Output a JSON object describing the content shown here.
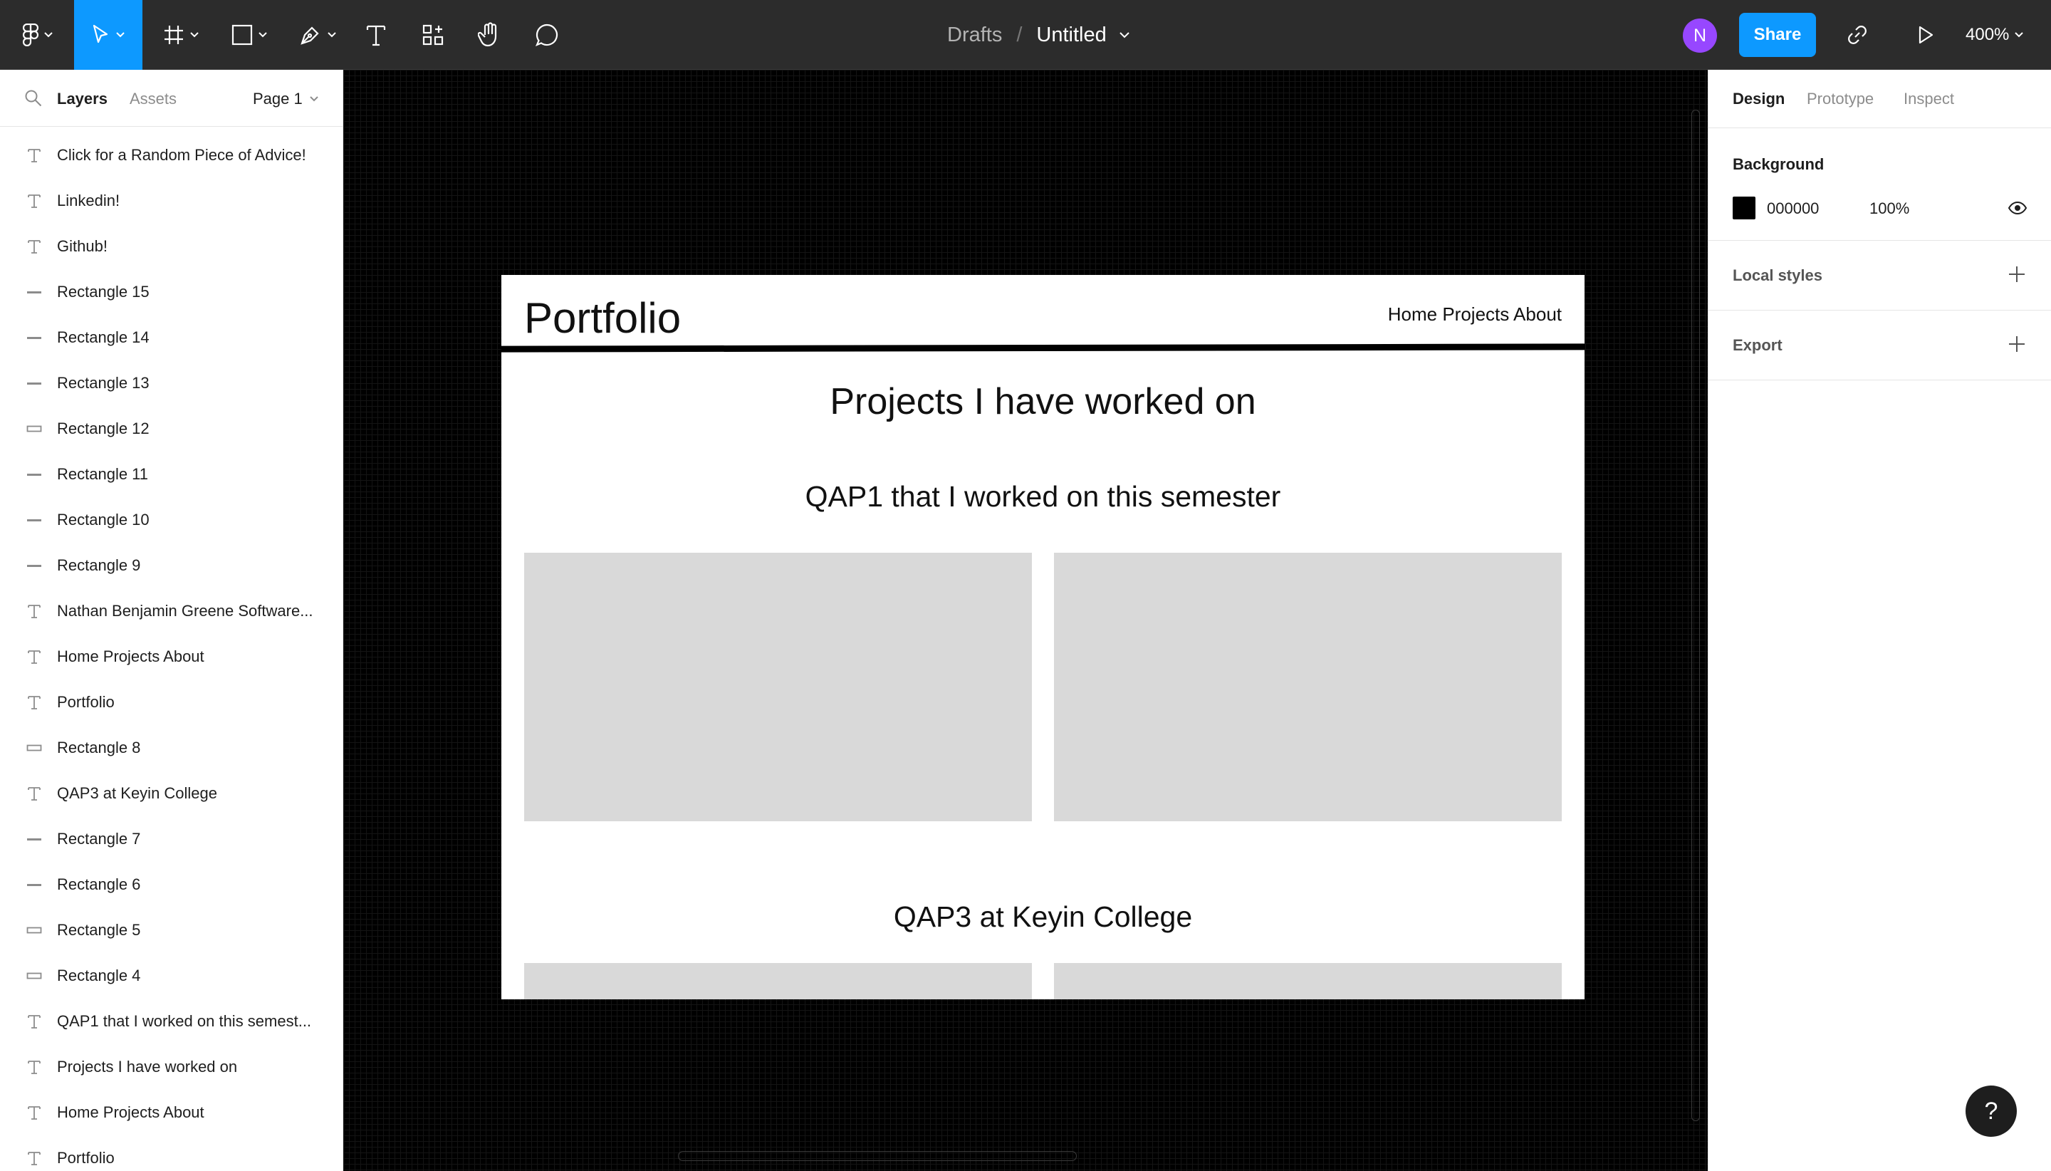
{
  "toolbar": {
    "breadcrumb_parent": "Drafts",
    "breadcrumb_separator": "/",
    "file_name": "Untitled",
    "avatar_initial": "N",
    "share_label": "Share",
    "zoom_level": "400%"
  },
  "left_panel": {
    "tab_layers": "Layers",
    "tab_assets": "Assets",
    "page_selector": "Page 1",
    "layers": [
      {
        "name": "Click for a Random Piece of Advice!",
        "icon": "text-icon"
      },
      {
        "name": "Linkedin!",
        "icon": "text-icon"
      },
      {
        "name": "Github!",
        "icon": "text-icon"
      },
      {
        "name": "Rectangle 15",
        "icon": "line-icon"
      },
      {
        "name": "Rectangle 14",
        "icon": "line-icon"
      },
      {
        "name": "Rectangle 13",
        "icon": "line-icon"
      },
      {
        "name": "Rectangle 12",
        "icon": "rectangle-icon"
      },
      {
        "name": "Rectangle 11",
        "icon": "line-icon"
      },
      {
        "name": "Rectangle 10",
        "icon": "line-icon"
      },
      {
        "name": "Rectangle 9",
        "icon": "line-icon"
      },
      {
        "name": "Nathan Benjamin Greene Software...",
        "icon": "text-icon"
      },
      {
        "name": "Home Projects About",
        "icon": "text-icon"
      },
      {
        "name": "Portfolio",
        "icon": "text-icon"
      },
      {
        "name": "Rectangle 8",
        "icon": "rectangle-icon"
      },
      {
        "name": "QAP3 at Keyin College",
        "icon": "text-icon"
      },
      {
        "name": "Rectangle 7",
        "icon": "line-icon"
      },
      {
        "name": "Rectangle 6",
        "icon": "line-icon"
      },
      {
        "name": "Rectangle 5",
        "icon": "rectangle-icon"
      },
      {
        "name": "Rectangle 4",
        "icon": "rectangle-icon"
      },
      {
        "name": "QAP1 that I worked on this semest...",
        "icon": "text-icon"
      },
      {
        "name": "Projects I have worked on",
        "icon": "text-icon"
      },
      {
        "name": "Home Projects About",
        "icon": "text-icon"
      },
      {
        "name": "Portfolio",
        "icon": "text-icon"
      }
    ]
  },
  "canvas": {
    "frame": {
      "title": "Portfolio",
      "nav": "Home Projects About",
      "heading": "Projects I have worked on",
      "section1_heading": "QAP1 that I worked on this semester",
      "section2_heading": "QAP3 at Keyin College",
      "placeholder_color": "#d9d9d9"
    }
  },
  "right_panel": {
    "tabs": [
      "Design",
      "Prototype",
      "Inspect"
    ],
    "background_label": "Background",
    "background_hex": "000000",
    "background_opacity": "100%",
    "local_styles_label": "Local styles",
    "export_label": "Export"
  },
  "colors": {
    "accent": "#0d99ff",
    "avatar": "#9747ff",
    "toolbar": "#2c2c2c"
  }
}
